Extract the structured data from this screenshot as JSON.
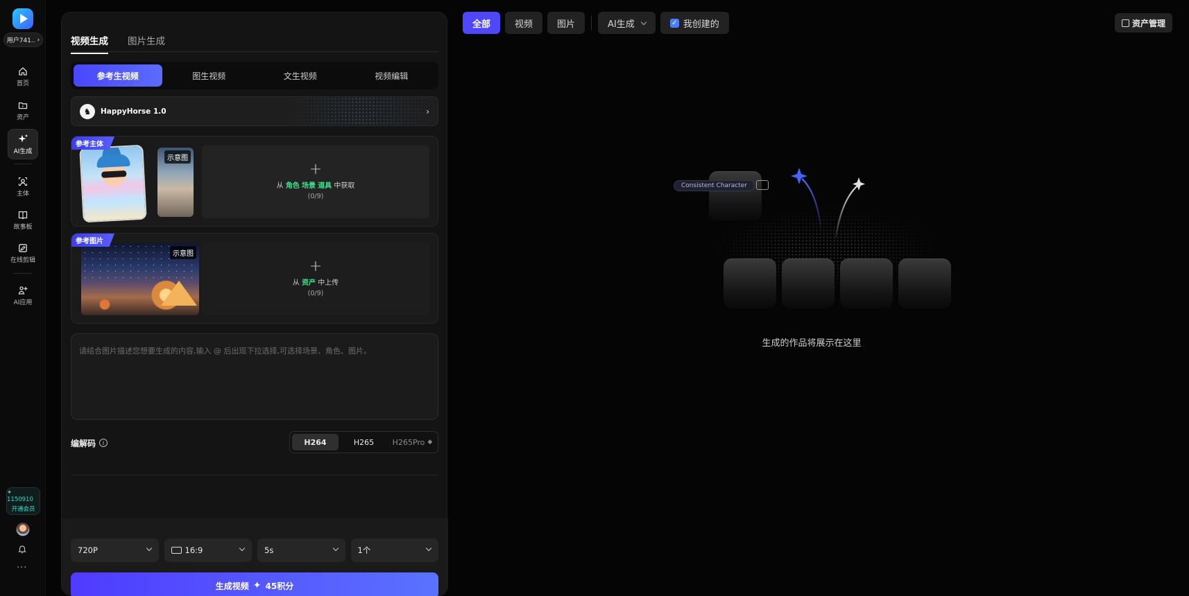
{
  "sidebar": {
    "user": "用户741..",
    "nav": [
      {
        "label": "首页",
        "icon": "home-icon"
      },
      {
        "label": "资产",
        "icon": "folder-icon"
      },
      {
        "label": "AI生成",
        "icon": "sparkle-icon"
      },
      {
        "label": "主体",
        "icon": "subject-icon"
      },
      {
        "label": "故事板",
        "icon": "storyboard-icon"
      },
      {
        "label": "在线剪辑",
        "icon": "edit-icon"
      },
      {
        "label": "AI应用",
        "icon": "apps-icon"
      }
    ],
    "credits_value": "1150910",
    "credits_cta": "开通会员",
    "more": "..."
  },
  "panel": {
    "top_tabs": [
      "视频生成",
      "图片生成"
    ],
    "modes": [
      "参考生视频",
      "图生视频",
      "文生视频",
      "视频编辑"
    ],
    "model": {
      "name": "HappyHorse 1.0"
    },
    "ref_subject": {
      "tag": "参考主体",
      "hint": "示意图",
      "line_prefix": "从",
      "links": [
        "角色",
        "场景",
        "道具"
      ],
      "line_suffix": "中获取",
      "count": "(0/9)"
    },
    "ref_image": {
      "tag": "参考图片",
      "hint": "示意图",
      "line_prefix": "从",
      "link": "资产",
      "line_suffix": "中上传",
      "count": "(0/9)"
    },
    "prompt_placeholder": "请结合图片描述您想要生成的内容,输入 @ 后出现下拉选择,可选择场景、角色、图片。",
    "codec": {
      "label": "编解码",
      "options": [
        "H264",
        "H265",
        "H265Pro"
      ],
      "selected": "H264"
    },
    "settings": {
      "resolution": "720P",
      "ratio": "16:9",
      "duration": "5s",
      "count": "1个"
    },
    "generate": {
      "label": "生成视频",
      "cost": "45积分"
    }
  },
  "filters": {
    "buttons": [
      "全部",
      "视频",
      "图片"
    ],
    "active": "全部",
    "ai_dropdown": "AI生成",
    "mine_checkbox": "我创建的",
    "mine_checked": true,
    "asset_manage": "资产管理"
  },
  "empty_state": {
    "tag": "Consistent Character",
    "text": "生成的作品将展示在这里"
  },
  "colors": {
    "accent": "#4f47ff",
    "green_link": "#3ee08a",
    "credits": "#35d7d0",
    "background": "#050505"
  }
}
